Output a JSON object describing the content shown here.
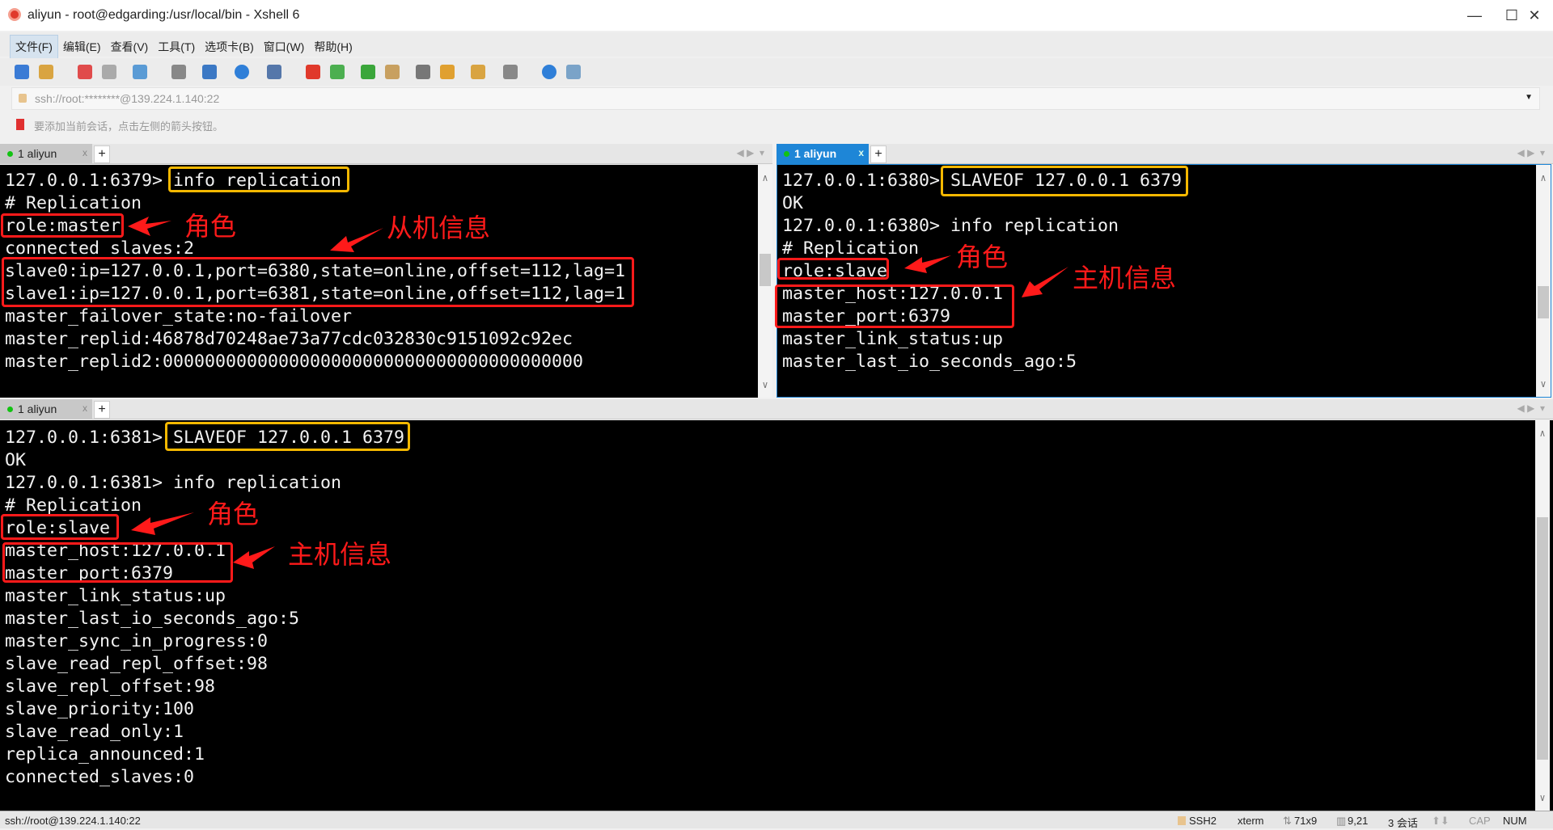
{
  "window": {
    "title": "aliyun - root@edgarding:/usr/local/bin - Xshell 6",
    "minimize": "—",
    "maximize": "☐",
    "close": "✕"
  },
  "menu": [
    "文件(F)",
    "编辑(E)",
    "查看(V)",
    "工具(T)",
    "选项卡(B)",
    "窗口(W)",
    "帮助(H)"
  ],
  "toolbar_icons": [
    "new-session-icon",
    "open-folder-icon",
    "disconnect-icon",
    "reconnect-icon",
    "properties-icon",
    "search-icon",
    "transfer-icon",
    "globe-icon",
    "font-icon",
    "xshell-icon",
    "xftp-icon",
    "fullscreen-icon",
    "lock-icon",
    "keyboard-icon",
    "highlight-icon",
    "new-folder-icon",
    "layout-icon",
    "help-icon",
    "chat-icon"
  ],
  "address": "ssh://root:********@139.224.1.140:22",
  "hint": "要添加当前会话，点击左侧的箭头按钮。",
  "tabs": {
    "label": "1 aliyun",
    "close": "x",
    "add": "+"
  },
  "panes": {
    "top_left": {
      "lines": [
        "127.0.0.1:6379> info replication",
        "# Replication",
        "role:master",
        "connected_slaves:2",
        "slave0:ip=127.0.0.1,port=6380,state=online,offset=112,lag=1",
        "slave1:ip=127.0.0.1,port=6381,state=online,offset=112,lag=1",
        "master_failover_state:no-failover",
        "master_replid:46878d70248ae73a77cdc032830c9151092c92ec",
        "master_replid2:0000000000000000000000000000000000000000"
      ],
      "notes": [
        "角色",
        "从机信息"
      ]
    },
    "top_right": {
      "lines": [
        "127.0.0.1:6380> SLAVEOF 127.0.0.1 6379",
        "OK",
        "127.0.0.1:6380> info replication",
        "# Replication",
        "role:slave",
        "master_host:127.0.0.1",
        "master_port:6379",
        "master_link_status:up",
        "master_last_io_seconds_ago:5"
      ],
      "notes": [
        "角色",
        "主机信息"
      ]
    },
    "bottom": {
      "lines": [
        "127.0.0.1:6381> SLAVEOF 127.0.0.1 6379",
        "OK",
        "127.0.0.1:6381> info replication",
        "# Replication",
        "role:slave",
        "master_host:127.0.0.1",
        "master_port:6379",
        "master_link_status:up",
        "master_last_io_seconds_ago:5",
        "master_sync_in_progress:0",
        "slave_read_repl_offset:98",
        "slave_repl_offset:98",
        "slave_priority:100",
        "slave_read_only:1",
        "replica_announced:1",
        "connected_slaves:0"
      ],
      "notes": [
        "角色",
        "主机信息"
      ]
    }
  },
  "status": {
    "connection": "ssh://root@139.224.1.140:22",
    "protocol": "SSH2",
    "term": "xterm",
    "size": "71x9",
    "cursor": "9,21",
    "sessions": "3 会话",
    "cap": "CAP",
    "num": "NUM"
  },
  "colors": {
    "annotation_red": "#ff1a1a",
    "highlight_yellow": "#f5b800",
    "active_tab": "#1e86d7"
  }
}
